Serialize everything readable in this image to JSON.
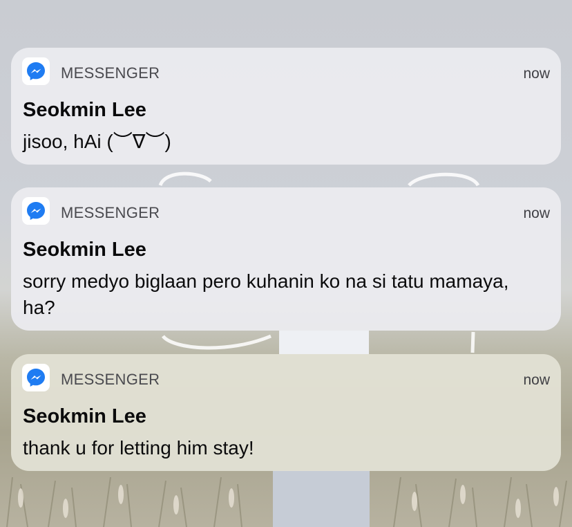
{
  "notifications": [
    {
      "app_name": "MESSENGER",
      "app_icon": "messenger-icon",
      "time": "now",
      "sender": "Seokmin Lee",
      "message": "jisoo, hAi  (︶∇︶)"
    },
    {
      "app_name": "MESSENGER",
      "app_icon": "messenger-icon",
      "time": "now",
      "sender": "Seokmin Lee",
      "message": "sorry medyo biglaan pero kuhanin ko na si tatu mamaya, ha?"
    },
    {
      "app_name": "MESSENGER",
      "app_icon": "messenger-icon",
      "time": "now",
      "sender": "Seokmin Lee",
      "message": "thank u for letting him stay!"
    }
  ],
  "colors": {
    "messenger_blue": "#1f7cf2",
    "card": "#ececf0"
  }
}
